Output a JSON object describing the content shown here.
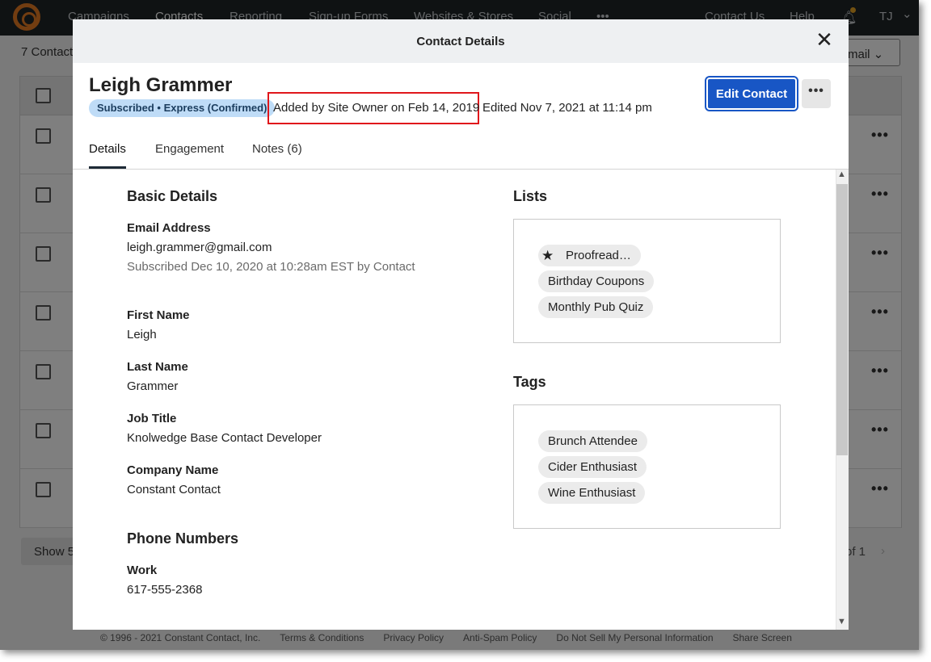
{
  "nav": {
    "items": [
      "Campaigns",
      "Contacts",
      "Reporting",
      "Sign-up Forms",
      "Websites & Stores",
      "Social"
    ],
    "more": "•••",
    "contact_us": "Contact Us",
    "help": "Help",
    "user_initials": "TJ",
    "chevron": "⌄",
    "bell_icon": "bell-icon"
  },
  "background": {
    "count": "7 Contact",
    "email_button": "mail ⌄",
    "show_button": "Show 5",
    "pages": "of 1",
    "next": "›",
    "row_menu": "•••",
    "footer": [
      "© 1996 - 2021 Constant Contact, Inc.",
      "Terms & Conditions",
      "Privacy Policy",
      "Anti-Spam Policy",
      "Do Not Sell My Personal Information",
      "Share Screen"
    ]
  },
  "modal": {
    "title": "Contact Details",
    "close": "✕",
    "name": "Leigh Grammer",
    "status_badge": "Subscribed • Express (Confirmed)",
    "added": "Added by Site Owner on Feb 14, 2019",
    "edited": "Edited Nov 7, 2021 at 11:14 pm",
    "edit_button": "Edit Contact",
    "more_button": "•••",
    "tabs": [
      "Details",
      "Engagement",
      "Notes (6)"
    ],
    "active_tab": "Details",
    "basic_details": {
      "title": "Basic Details",
      "email_label": "Email Address",
      "email_value": "leigh.grammer@gmail.com",
      "email_note": "Subscribed Dec 10, 2020 at 10:28am EST by Contact",
      "first_name_label": "First Name",
      "first_name_value": "Leigh",
      "last_name_label": "Last Name",
      "last_name_value": "Grammer",
      "job_title_label": "Job Title",
      "job_title_value": "Knolwedge Base Contact Developer",
      "company_label": "Company Name",
      "company_value": "Constant Contact"
    },
    "phone": {
      "title": "Phone Numbers",
      "work_label": "Work",
      "work_value": "617-555-2368"
    },
    "lists": {
      "title": "Lists",
      "items": [
        "Proofread…",
        "Birthday Coupons",
        "Monthly Pub Quiz"
      ],
      "star": "★"
    },
    "tags": {
      "title": "Tags",
      "items": [
        "Brunch Attendee",
        "Cider Enthusiast",
        "Wine Enthusiast"
      ]
    },
    "scroll_up": "▲",
    "scroll_down": "▼"
  },
  "colors": {
    "primary": "#1856c5",
    "highlight_box": "#e0161b",
    "badge_bg": "#bfdcf7",
    "nav_bg": "#1f2427",
    "logo": "#e57b23"
  }
}
